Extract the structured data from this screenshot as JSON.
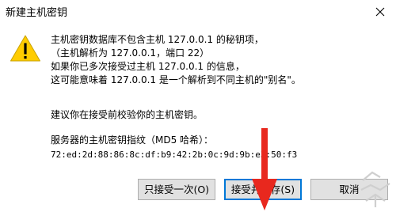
{
  "window": {
    "title": "新建主机密钥",
    "close_glyph": "✕"
  },
  "message": {
    "line1": "主机密钥数据库不包含主机 127.0.0.1 的秘钥项，",
    "line2": "（主机解析为 127.0.0.1，端口 22）",
    "line3": "如果你已多次接受过主机 127.0.0.1 的信息，",
    "line4": "这可能意味着 127.0.0.1 是一个解析到不同主机的\"别名\"。",
    "advice": "建议你在接受前校验你的主机密钥。",
    "fingerprint_label": "服务器的主机密钥指纹（MD5 哈希）：",
    "fingerprint_value": "72:ed:2d:88:86:8c:df:b9:42:2b:0c:9d:9b:e3:50:f3"
  },
  "buttons": {
    "accept_once": "只接受一次(O)",
    "accept_and_save": "接受并保存(S)",
    "cancel": "取消"
  },
  "colors": {
    "warning_yellow": "#ffcc00",
    "focus_blue": "#0078d7",
    "arrow_red": "#e8281e"
  }
}
